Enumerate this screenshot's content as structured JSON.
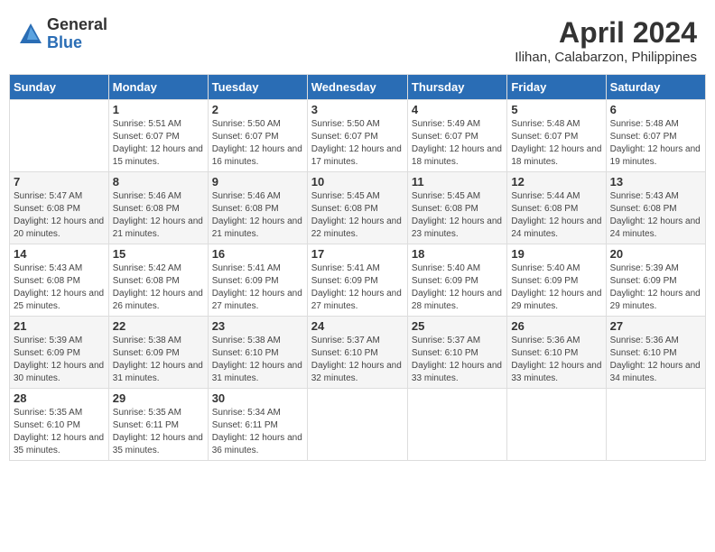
{
  "header": {
    "logo_general": "General",
    "logo_blue": "Blue",
    "month_title": "April 2024",
    "location": "Ilihan, Calabarzon, Philippines"
  },
  "days_of_week": [
    "Sunday",
    "Monday",
    "Tuesday",
    "Wednesday",
    "Thursday",
    "Friday",
    "Saturday"
  ],
  "weeks": [
    [
      {
        "day": "",
        "sunrise": "",
        "sunset": "",
        "daylight": ""
      },
      {
        "day": "1",
        "sunrise": "Sunrise: 5:51 AM",
        "sunset": "Sunset: 6:07 PM",
        "daylight": "Daylight: 12 hours and 15 minutes."
      },
      {
        "day": "2",
        "sunrise": "Sunrise: 5:50 AM",
        "sunset": "Sunset: 6:07 PM",
        "daylight": "Daylight: 12 hours and 16 minutes."
      },
      {
        "day": "3",
        "sunrise": "Sunrise: 5:50 AM",
        "sunset": "Sunset: 6:07 PM",
        "daylight": "Daylight: 12 hours and 17 minutes."
      },
      {
        "day": "4",
        "sunrise": "Sunrise: 5:49 AM",
        "sunset": "Sunset: 6:07 PM",
        "daylight": "Daylight: 12 hours and 18 minutes."
      },
      {
        "day": "5",
        "sunrise": "Sunrise: 5:48 AM",
        "sunset": "Sunset: 6:07 PM",
        "daylight": "Daylight: 12 hours and 18 minutes."
      },
      {
        "day": "6",
        "sunrise": "Sunrise: 5:48 AM",
        "sunset": "Sunset: 6:07 PM",
        "daylight": "Daylight: 12 hours and 19 minutes."
      }
    ],
    [
      {
        "day": "7",
        "sunrise": "Sunrise: 5:47 AM",
        "sunset": "Sunset: 6:08 PM",
        "daylight": "Daylight: 12 hours and 20 minutes."
      },
      {
        "day": "8",
        "sunrise": "Sunrise: 5:46 AM",
        "sunset": "Sunset: 6:08 PM",
        "daylight": "Daylight: 12 hours and 21 minutes."
      },
      {
        "day": "9",
        "sunrise": "Sunrise: 5:46 AM",
        "sunset": "Sunset: 6:08 PM",
        "daylight": "Daylight: 12 hours and 21 minutes."
      },
      {
        "day": "10",
        "sunrise": "Sunrise: 5:45 AM",
        "sunset": "Sunset: 6:08 PM",
        "daylight": "Daylight: 12 hours and 22 minutes."
      },
      {
        "day": "11",
        "sunrise": "Sunrise: 5:45 AM",
        "sunset": "Sunset: 6:08 PM",
        "daylight": "Daylight: 12 hours and 23 minutes."
      },
      {
        "day": "12",
        "sunrise": "Sunrise: 5:44 AM",
        "sunset": "Sunset: 6:08 PM",
        "daylight": "Daylight: 12 hours and 24 minutes."
      },
      {
        "day": "13",
        "sunrise": "Sunrise: 5:43 AM",
        "sunset": "Sunset: 6:08 PM",
        "daylight": "Daylight: 12 hours and 24 minutes."
      }
    ],
    [
      {
        "day": "14",
        "sunrise": "Sunrise: 5:43 AM",
        "sunset": "Sunset: 6:08 PM",
        "daylight": "Daylight: 12 hours and 25 minutes."
      },
      {
        "day": "15",
        "sunrise": "Sunrise: 5:42 AM",
        "sunset": "Sunset: 6:08 PM",
        "daylight": "Daylight: 12 hours and 26 minutes."
      },
      {
        "day": "16",
        "sunrise": "Sunrise: 5:41 AM",
        "sunset": "Sunset: 6:09 PM",
        "daylight": "Daylight: 12 hours and 27 minutes."
      },
      {
        "day": "17",
        "sunrise": "Sunrise: 5:41 AM",
        "sunset": "Sunset: 6:09 PM",
        "daylight": "Daylight: 12 hours and 27 minutes."
      },
      {
        "day": "18",
        "sunrise": "Sunrise: 5:40 AM",
        "sunset": "Sunset: 6:09 PM",
        "daylight": "Daylight: 12 hours and 28 minutes."
      },
      {
        "day": "19",
        "sunrise": "Sunrise: 5:40 AM",
        "sunset": "Sunset: 6:09 PM",
        "daylight": "Daylight: 12 hours and 29 minutes."
      },
      {
        "day": "20",
        "sunrise": "Sunrise: 5:39 AM",
        "sunset": "Sunset: 6:09 PM",
        "daylight": "Daylight: 12 hours and 29 minutes."
      }
    ],
    [
      {
        "day": "21",
        "sunrise": "Sunrise: 5:39 AM",
        "sunset": "Sunset: 6:09 PM",
        "daylight": "Daylight: 12 hours and 30 minutes."
      },
      {
        "day": "22",
        "sunrise": "Sunrise: 5:38 AM",
        "sunset": "Sunset: 6:09 PM",
        "daylight": "Daylight: 12 hours and 31 minutes."
      },
      {
        "day": "23",
        "sunrise": "Sunrise: 5:38 AM",
        "sunset": "Sunset: 6:10 PM",
        "daylight": "Daylight: 12 hours and 31 minutes."
      },
      {
        "day": "24",
        "sunrise": "Sunrise: 5:37 AM",
        "sunset": "Sunset: 6:10 PM",
        "daylight": "Daylight: 12 hours and 32 minutes."
      },
      {
        "day": "25",
        "sunrise": "Sunrise: 5:37 AM",
        "sunset": "Sunset: 6:10 PM",
        "daylight": "Daylight: 12 hours and 33 minutes."
      },
      {
        "day": "26",
        "sunrise": "Sunrise: 5:36 AM",
        "sunset": "Sunset: 6:10 PM",
        "daylight": "Daylight: 12 hours and 33 minutes."
      },
      {
        "day": "27",
        "sunrise": "Sunrise: 5:36 AM",
        "sunset": "Sunset: 6:10 PM",
        "daylight": "Daylight: 12 hours and 34 minutes."
      }
    ],
    [
      {
        "day": "28",
        "sunrise": "Sunrise: 5:35 AM",
        "sunset": "Sunset: 6:10 PM",
        "daylight": "Daylight: 12 hours and 35 minutes."
      },
      {
        "day": "29",
        "sunrise": "Sunrise: 5:35 AM",
        "sunset": "Sunset: 6:11 PM",
        "daylight": "Daylight: 12 hours and 35 minutes."
      },
      {
        "day": "30",
        "sunrise": "Sunrise: 5:34 AM",
        "sunset": "Sunset: 6:11 PM",
        "daylight": "Daylight: 12 hours and 36 minutes."
      },
      {
        "day": "",
        "sunrise": "",
        "sunset": "",
        "daylight": ""
      },
      {
        "day": "",
        "sunrise": "",
        "sunset": "",
        "daylight": ""
      },
      {
        "day": "",
        "sunrise": "",
        "sunset": "",
        "daylight": ""
      },
      {
        "day": "",
        "sunrise": "",
        "sunset": "",
        "daylight": ""
      }
    ]
  ]
}
